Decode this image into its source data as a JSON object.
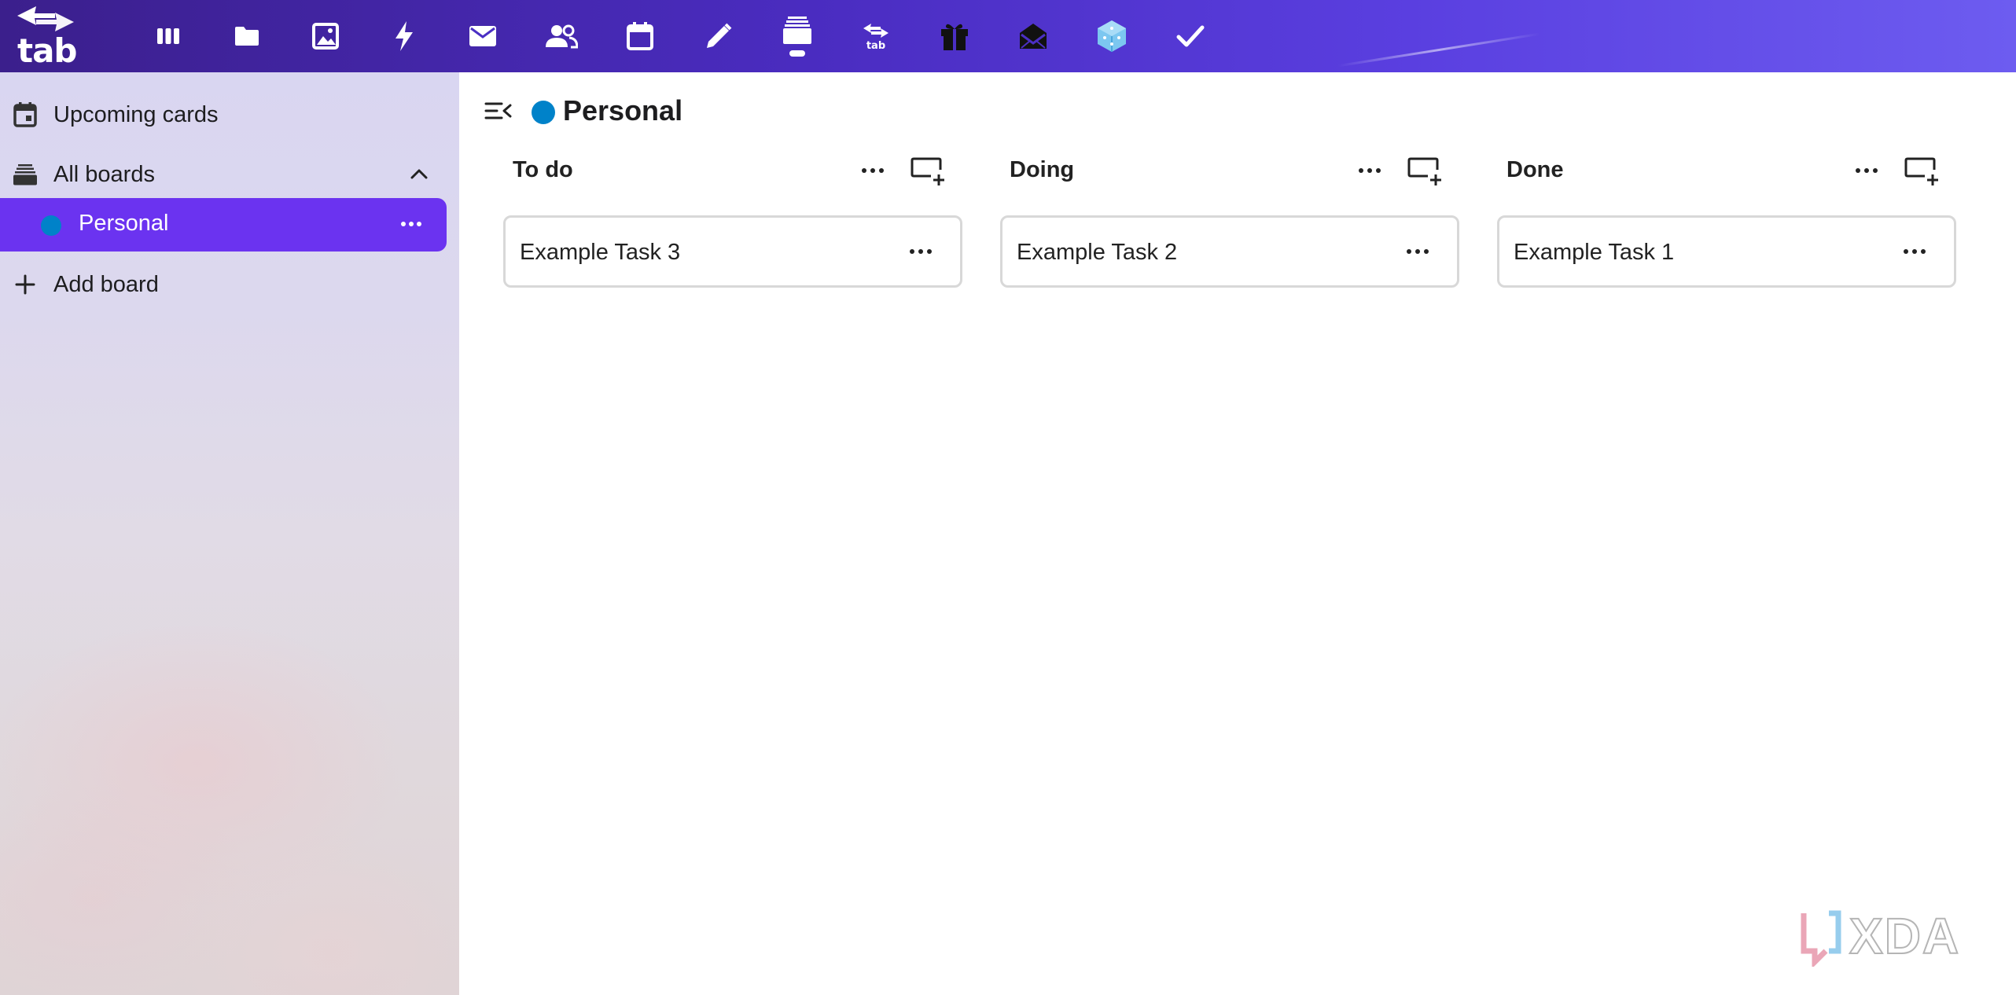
{
  "topbar": {
    "logo_text": "tab",
    "apps": [
      {
        "icon": "columns-icon"
      },
      {
        "icon": "folder-icon"
      },
      {
        "icon": "image-icon"
      },
      {
        "icon": "lightning-icon"
      },
      {
        "icon": "mail-icon"
      },
      {
        "icon": "contacts-icon"
      },
      {
        "icon": "calendar-icon"
      },
      {
        "icon": "pencil-icon"
      },
      {
        "icon": "deck-icon"
      },
      {
        "icon": "tab-logo-icon",
        "label": "tab"
      },
      {
        "icon": "gift-icon"
      },
      {
        "icon": "envelope-open-icon"
      },
      {
        "icon": "cube-icon"
      },
      {
        "icon": "checkmark-icon"
      }
    ]
  },
  "sidebar": {
    "upcoming_label": "Upcoming cards",
    "all_boards_label": "All boards",
    "boards": [
      {
        "label": "Personal",
        "color": "#0082c9"
      }
    ],
    "add_board_label": "Add board",
    "active_color": "#6b33f0"
  },
  "board": {
    "title": "Personal",
    "color": "#0082c9",
    "columns": [
      {
        "title": "To do",
        "cards": [
          {
            "title": "Example Task 3"
          }
        ]
      },
      {
        "title": "Doing",
        "cards": [
          {
            "title": "Example Task 2"
          }
        ]
      },
      {
        "title": "Done",
        "cards": [
          {
            "title": "Example Task 1"
          }
        ]
      }
    ]
  },
  "watermark": {
    "text": "XDA"
  }
}
